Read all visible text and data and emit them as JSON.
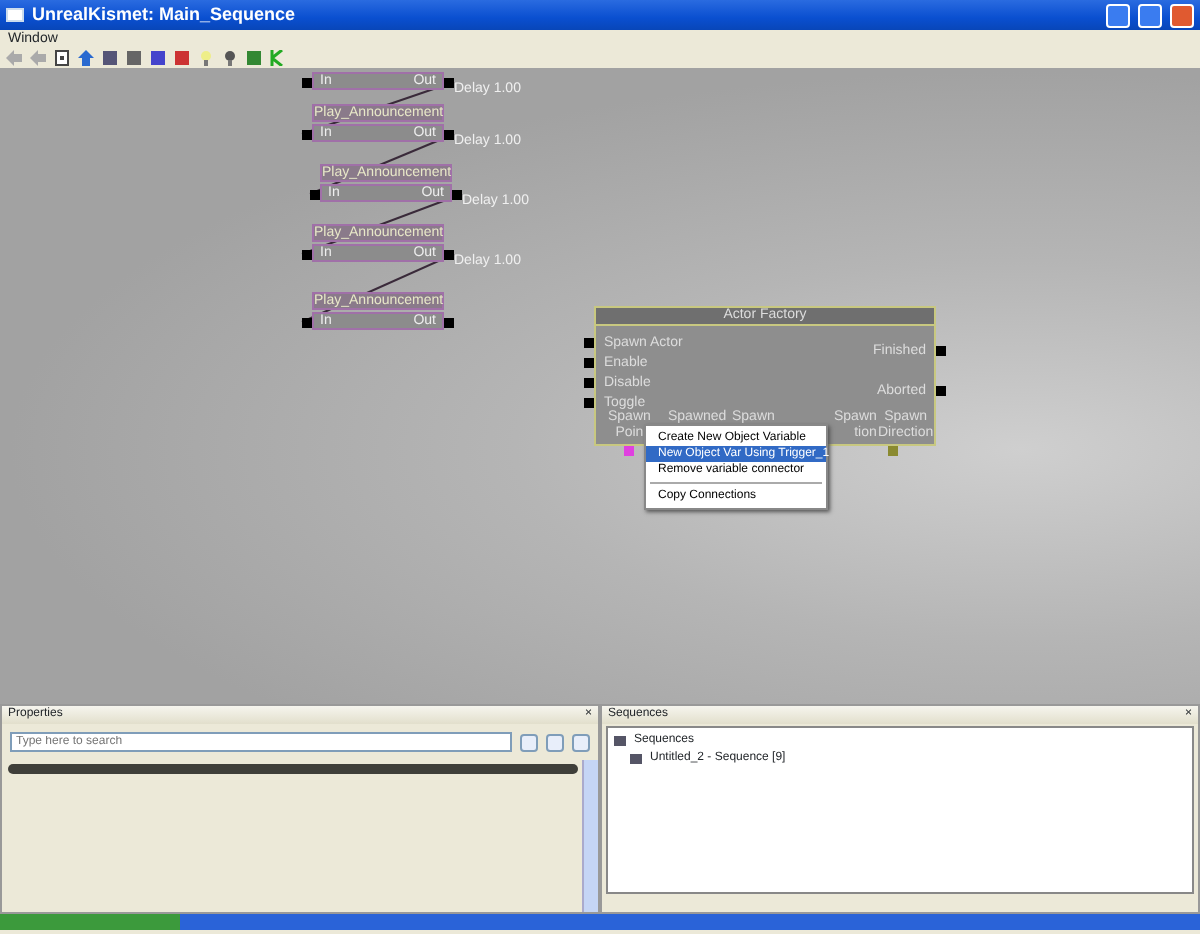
{
  "window": {
    "title": "UnrealKismet: Main_Sequence"
  },
  "menu": [
    "Window"
  ],
  "canvas": {
    "sequence_nodes": [
      {
        "in": "In",
        "out": "Out",
        "delay": "Delay 1.00"
      },
      {
        "title": "Play_Announcement",
        "in": "In",
        "out": "Out",
        "delay": "Delay 1.00"
      },
      {
        "title": "Play_Announcement",
        "in": "In",
        "out": "Out",
        "delay": "Delay 1.00"
      },
      {
        "title": "Play_Announcement",
        "in": "In",
        "out": "Out",
        "delay": "Delay 1.00"
      },
      {
        "title": "Play_Announcement",
        "in": "In",
        "out": "Out"
      }
    ],
    "actor_factory": {
      "title": "Actor Factory",
      "inputs": [
        "Spawn Actor",
        "Enable",
        "Disable",
        "Toggle"
      ],
      "outputs": [
        "Finished",
        "Aborted"
      ],
      "variables": [
        {
          "lines": [
            "Spawn",
            "Poin"
          ],
          "color": "#e040e0"
        },
        {
          "lines": [
            "Spawned"
          ]
        },
        {
          "lines": [
            "Spawn"
          ]
        },
        {
          "lines": [
            "Spawn",
            "tion"
          ]
        },
        {
          "lines": [
            "Spawn",
            "Direction"
          ],
          "color": "#8a8a30"
        }
      ]
    },
    "context_menu": [
      {
        "label": "Create New Object Variable",
        "selected": false
      },
      {
        "label": "New Object Var Using Trigger_1",
        "selected": true
      },
      {
        "label": "Remove variable connector",
        "selected": false,
        "separator_after": true
      },
      {
        "label": "Copy Connections",
        "selected": false
      }
    ]
  },
  "properties": {
    "title": "Properties",
    "close": "×",
    "search": {
      "placeholder": "Type here to search"
    }
  },
  "sequences": {
    "title": "Sequences",
    "close": "×",
    "tree": [
      {
        "label": "Sequences",
        "children": [
          {
            "label": "Untitled_2 - Sequence [9]"
          }
        ]
      }
    ]
  }
}
